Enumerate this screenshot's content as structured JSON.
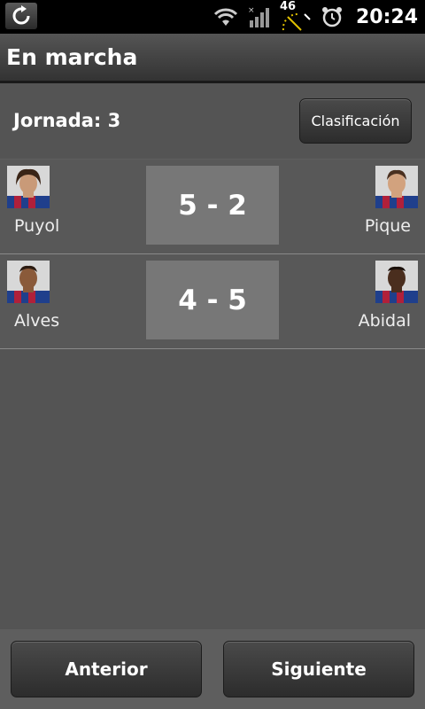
{
  "status_bar": {
    "time": "20:24",
    "speed_gauge_value": "46",
    "icons": [
      "refresh-icon",
      "wifi-icon",
      "signal-icon",
      "speed-gauge-icon",
      "alarm-clock-icon"
    ]
  },
  "app": {
    "title": "En marcha"
  },
  "round": {
    "label": "Jornada: 3",
    "standings_button": "Clasificación"
  },
  "matches": [
    {
      "home_player": "Puyol",
      "score": "5 - 2",
      "away_player": "Pique"
    },
    {
      "home_player": "Alves",
      "score": "4 - 5",
      "away_player": "Abidal"
    }
  ],
  "navigation": {
    "previous": "Anterior",
    "next": "Siguiente"
  },
  "colors": {
    "background": "#545454",
    "score_box": "#777777",
    "jersey_blue": "#1f3f8c",
    "jersey_red": "#b0203a"
  }
}
